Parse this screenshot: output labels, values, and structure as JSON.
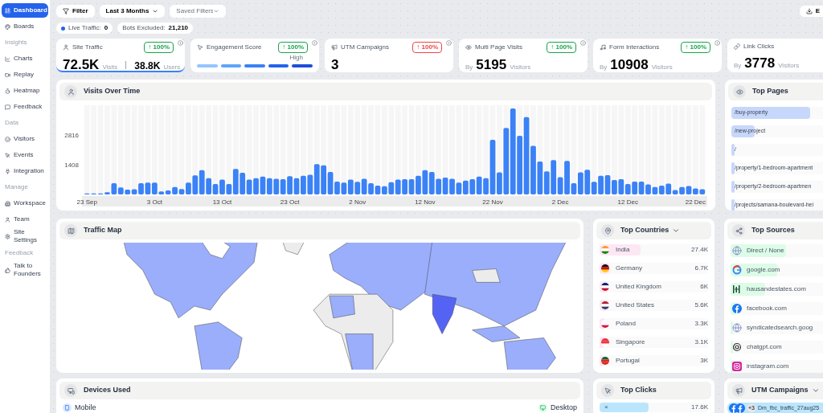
{
  "sidebar": {
    "items": [
      {
        "kind": "item",
        "label": "Dashboard",
        "selected": true
      },
      {
        "kind": "item",
        "label": "Boards",
        "selected": false
      },
      {
        "kind": "section",
        "label": "Insights"
      },
      {
        "kind": "item",
        "label": "Charts",
        "selected": false
      },
      {
        "kind": "item",
        "label": "Replay",
        "selected": false
      },
      {
        "kind": "item",
        "label": "Heatmap",
        "selected": false
      },
      {
        "kind": "item",
        "label": "Feedback",
        "selected": false
      },
      {
        "kind": "section",
        "label": "Data"
      },
      {
        "kind": "item",
        "label": "Visitors",
        "selected": false
      },
      {
        "kind": "item",
        "label": "Events",
        "selected": false
      },
      {
        "kind": "item",
        "label": "Integration",
        "selected": false
      },
      {
        "kind": "section",
        "label": "Manage"
      },
      {
        "kind": "item",
        "label": "Workspace",
        "selected": false
      },
      {
        "kind": "item",
        "label": "Team",
        "selected": false
      },
      {
        "kind": "item",
        "label": "Site Settings",
        "selected": false
      },
      {
        "kind": "section",
        "label": "Feedback"
      },
      {
        "kind": "item",
        "label": "Talk to Founders",
        "selected": false
      }
    ]
  },
  "toolbar": {
    "filter": "Filter",
    "range": "Last 3 Months",
    "saved_filters": {
      "placeholder": "Saved Filters"
    },
    "export": "E"
  },
  "status": {
    "live_label": "Live Traffic:",
    "live_value": "0",
    "bots_label": "Bots Excluded:",
    "bots_value": "21,210"
  },
  "metrics": [
    {
      "kind": "split",
      "title": "Site Traffic",
      "selected": true,
      "badge": {
        "text": "↑ 100%",
        "color": "#16a34a"
      },
      "value": "72.5K",
      "unit": "Visits",
      "value_2": "38.8K",
      "unit_2": "Users"
    },
    {
      "kind": "meter",
      "title": "Engagement Score",
      "selected": false,
      "badge": {
        "text": "↑ 100%",
        "color": "#16a34a"
      },
      "label": "High"
    },
    {
      "kind": "plain",
      "title": "UTM Campaigns",
      "selected": false,
      "badge": {
        "text": "↑ 100%",
        "color": "#ef4444"
      },
      "value": "3"
    },
    {
      "kind": "by",
      "title": "Multi Page Visits",
      "selected": false,
      "badge": {
        "text": "↑ 100%",
        "color": "#16a34a"
      },
      "prefix": "By",
      "value": "5195",
      "unit": "Visitors"
    },
    {
      "kind": "by",
      "title": "Form Interactions",
      "selected": false,
      "badge": {
        "text": "↑ 100%",
        "color": "#16a34a"
      },
      "prefix": "By",
      "value": "10908",
      "unit": "Visitors"
    },
    {
      "kind": "by",
      "title": "Link Clicks",
      "selected": false,
      "prefix": "By",
      "value": "3778",
      "unit": "Visitors"
    }
  ],
  "visits_over_time": {
    "title": "Visits Over Time",
    "chart_data": {
      "type": "bar",
      "ylim": [
        0,
        4200
      ],
      "yticks": [
        1408,
        2816
      ],
      "categories": [
        "23 Sep",
        null,
        null,
        null,
        null,
        null,
        null,
        null,
        null,
        null,
        "3 Oct",
        null,
        null,
        null,
        null,
        null,
        null,
        null,
        null,
        null,
        "13 Oct",
        null,
        null,
        null,
        null,
        null,
        null,
        null,
        null,
        null,
        "23 Oct",
        null,
        null,
        null,
        null,
        null,
        null,
        null,
        null,
        null,
        "2 Nov",
        null,
        null,
        null,
        null,
        null,
        null,
        null,
        null,
        null,
        "12 Nov",
        null,
        null,
        null,
        null,
        null,
        null,
        null,
        null,
        null,
        "22 Nov",
        null,
        null,
        null,
        null,
        null,
        null,
        null,
        null,
        null,
        "2 Dec",
        null,
        null,
        null,
        null,
        null,
        null,
        null,
        null,
        null,
        "12 Dec",
        null,
        null,
        null,
        null,
        null,
        null,
        null,
        null,
        null,
        "22 Dec",
        null
      ],
      "values": [
        50,
        50,
        50,
        100,
        530,
        330,
        230,
        250,
        530,
        560,
        560,
        140,
        190,
        350,
        260,
        560,
        900,
        1140,
        770,
        490,
        700,
        490,
        1200,
        1020,
        700,
        770,
        840,
        770,
        740,
        720,
        860,
        770,
        880,
        930,
        1430,
        1370,
        1060,
        610,
        560,
        700,
        600,
        740,
        530,
        420,
        390,
        580,
        700,
        720,
        720,
        880,
        1140,
        1060,
        740,
        790,
        740,
        560,
        650,
        720,
        840,
        770,
        2570,
        1040,
        3130,
        4050,
        2760,
        3640,
        2290,
        1550,
        1090,
        1620,
        810,
        1580,
        530,
        1040,
        1160,
        600,
        880,
        910,
        680,
        720,
        490,
        610,
        610,
        470,
        350,
        420,
        510,
        210,
        350,
        400,
        280,
        250
      ]
    }
  },
  "top_pages": {
    "title": "Top Pages",
    "rows": [
      {
        "label": "/buy-property",
        "level": 0.68
      },
      {
        "label": "/new-project",
        "level": 0.2
      },
      {
        "label": "/",
        "level": 0.03
      },
      {
        "label": "/property/1-bedroom-apartment",
        "level": 0.03
      },
      {
        "label": "/property/2-bedroom-apartmen",
        "level": 0.03
      },
      {
        "label": "/projects/samana-boulevard-hei",
        "level": 0.03
      }
    ]
  },
  "traffic_map": {
    "title": "Traffic Map"
  },
  "top_countries": {
    "title": "Top Countries",
    "rows": [
      {
        "name": "India",
        "value": "27.4K",
        "level": 0.38
      },
      {
        "name": "Germany",
        "value": "6.7K",
        "level": 0.09
      },
      {
        "name": "United Kingdom",
        "value": "6K",
        "level": 0.08
      },
      {
        "name": "United States",
        "value": "5.6K",
        "level": 0.08
      },
      {
        "name": "Poland",
        "value": "3.3K",
        "level": 0.05
      },
      {
        "name": "Singapore",
        "value": "3.1K",
        "level": 0.04
      },
      {
        "name": "Portugal",
        "value": "3K",
        "level": 0.04
      }
    ]
  },
  "top_sources": {
    "title": "Top Sources",
    "rows": [
      {
        "name": "Direct / None",
        "level": 0.48
      },
      {
        "name": "google.com",
        "level": 0.4
      },
      {
        "name": "hausandestates.com",
        "level": 0.3
      },
      {
        "name": "facebook.com",
        "level": 0.05
      },
      {
        "name": "syndicatedsearch.goog",
        "level": 0.02
      },
      {
        "name": "chatgpt.com",
        "level": 0.02
      },
      {
        "name": "instagram.com",
        "level": 0.02
      }
    ]
  },
  "devices_used": {
    "title": "Devices Used",
    "left": "Mobile",
    "right": "Desktop"
  },
  "top_clicks": {
    "title": "Top Clicks",
    "rows": [
      {
        "label": "×",
        "value": "17.6K",
        "level": 0.45
      }
    ]
  },
  "utm_campaigns": {
    "title": "UTM Campaigns",
    "rows": [
      {
        "more": "+3",
        "name": "Dm_fbc_traffic_27aug25"
      }
    ]
  }
}
